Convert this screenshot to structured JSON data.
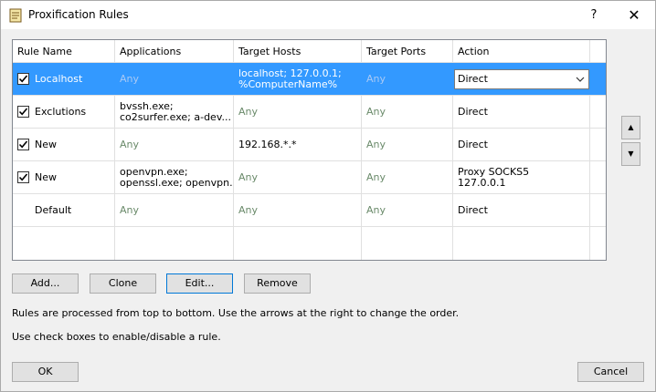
{
  "window": {
    "title": "Proxification Rules",
    "help_label": "?",
    "close_label": "✕"
  },
  "table": {
    "columns": [
      "Rule Name",
      "Applications",
      "Target Hosts",
      "Target Ports",
      "Action"
    ],
    "rows": [
      {
        "checked": true,
        "name": "Localhost",
        "applications": [
          "Any"
        ],
        "hosts": [
          "localhost; 127.0.0.1;",
          "%ComputerName%"
        ],
        "ports": "Any",
        "action": [
          "Direct"
        ],
        "selected": true
      },
      {
        "checked": true,
        "name": "Exclutions",
        "applications": [
          "bvssh.exe;",
          "co2surfer.exe; a-dev..."
        ],
        "hosts": [
          "Any"
        ],
        "ports": "Any",
        "action": [
          "Direct"
        ]
      },
      {
        "checked": true,
        "name": "New",
        "applications": [
          "Any"
        ],
        "hosts": [
          "192.168.*.*"
        ],
        "ports": "Any",
        "action": [
          "Direct"
        ]
      },
      {
        "checked": true,
        "name": "New",
        "applications": [
          "openvpn.exe;",
          "openssl.exe; openvpn..."
        ],
        "hosts": [
          "Any"
        ],
        "ports": "Any",
        "action": [
          "Proxy SOCKS5",
          "127.0.0.1"
        ]
      },
      {
        "checked": false,
        "name": "Default",
        "applications": [
          "Any"
        ],
        "hosts": [
          "Any"
        ],
        "ports": "Any",
        "action": [
          "Direct"
        ]
      }
    ],
    "selected_action_value": "Direct"
  },
  "order_buttons": {
    "up": "▲",
    "down": "▼"
  },
  "buttons": {
    "add": "Add...",
    "clone": "Clone",
    "edit": "Edit...",
    "remove": "Remove",
    "ok": "OK",
    "cancel": "Cancel"
  },
  "notes": {
    "order": "Rules are processed from top to bottom. Use the arrows at the right to change the order.",
    "checkboxes": "Use check boxes to enable/disable a rule."
  }
}
